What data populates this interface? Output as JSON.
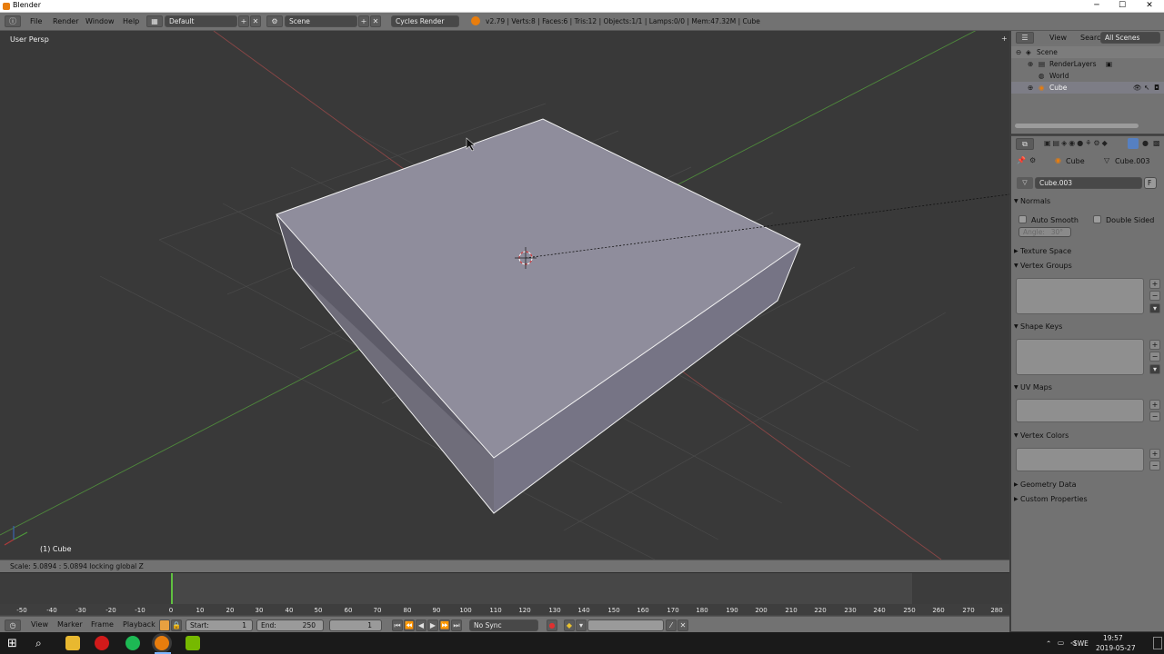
{
  "window": {
    "title": "Blender",
    "min": "─",
    "max": "☐",
    "close": "✕"
  },
  "info": {
    "menus": [
      "File",
      "Render",
      "Window",
      "Help"
    ],
    "layout": "Default",
    "scene": "Scene",
    "engine": "Cycles Render",
    "stats": "v2.79 | Verts:8 | Faces:6 | Tris:12 | Objects:1/1 | Lamps:0/0 | Mem:47.32M | Cube"
  },
  "viewport": {
    "view_label": "User Persp",
    "object_label": "(1) Cube",
    "status": "Scale: 5.0894 : 5.0894 locking global Z"
  },
  "timeline": {
    "ruler": [
      "-50",
      "-40",
      "-30",
      "-20",
      "-10",
      "0",
      "10",
      "20",
      "30",
      "40",
      "50",
      "60",
      "70",
      "80",
      "90",
      "100",
      "110",
      "120",
      "130",
      "140",
      "150",
      "160",
      "170",
      "180",
      "190",
      "200",
      "210",
      "220",
      "230",
      "240",
      "250",
      "260",
      "270",
      "280"
    ],
    "menus": [
      "View",
      "Marker",
      "Frame",
      "Playback"
    ],
    "start_label": "Start:",
    "start_value": "1",
    "end_label": "End:",
    "end_value": "250",
    "current_frame": "1",
    "sync": "No Sync"
  },
  "outliner": {
    "tabs": [
      "View",
      "Search",
      "All Scenes"
    ],
    "items": [
      "Scene",
      "RenderLayers",
      "World",
      "Cube"
    ]
  },
  "properties": {
    "breadcrumb_object": "Cube",
    "breadcrumb_mesh": "Cube.003",
    "mesh_name": "Cube.003",
    "fake_user": "F",
    "normals": "Normals",
    "auto_smooth": "Auto Smooth",
    "double_sided": "Double Sided",
    "angle": "Angle:",
    "angle_value": "30°",
    "texture_space": "Texture Space",
    "vertex_groups": "Vertex Groups",
    "shape_keys": "Shape Keys",
    "uv_maps": "UV Maps",
    "vertex_colors": "Vertex Colors",
    "geometry_data": "Geometry Data",
    "custom_properties": "Custom Properties"
  },
  "taskbar": {
    "lang": "SWE",
    "time": "19:57",
    "date": "2019-05-27"
  },
  "colors": {
    "blender_orange": "#e87d0d",
    "selection_blue": "#5680c2",
    "playhead_green": "#60c040"
  }
}
